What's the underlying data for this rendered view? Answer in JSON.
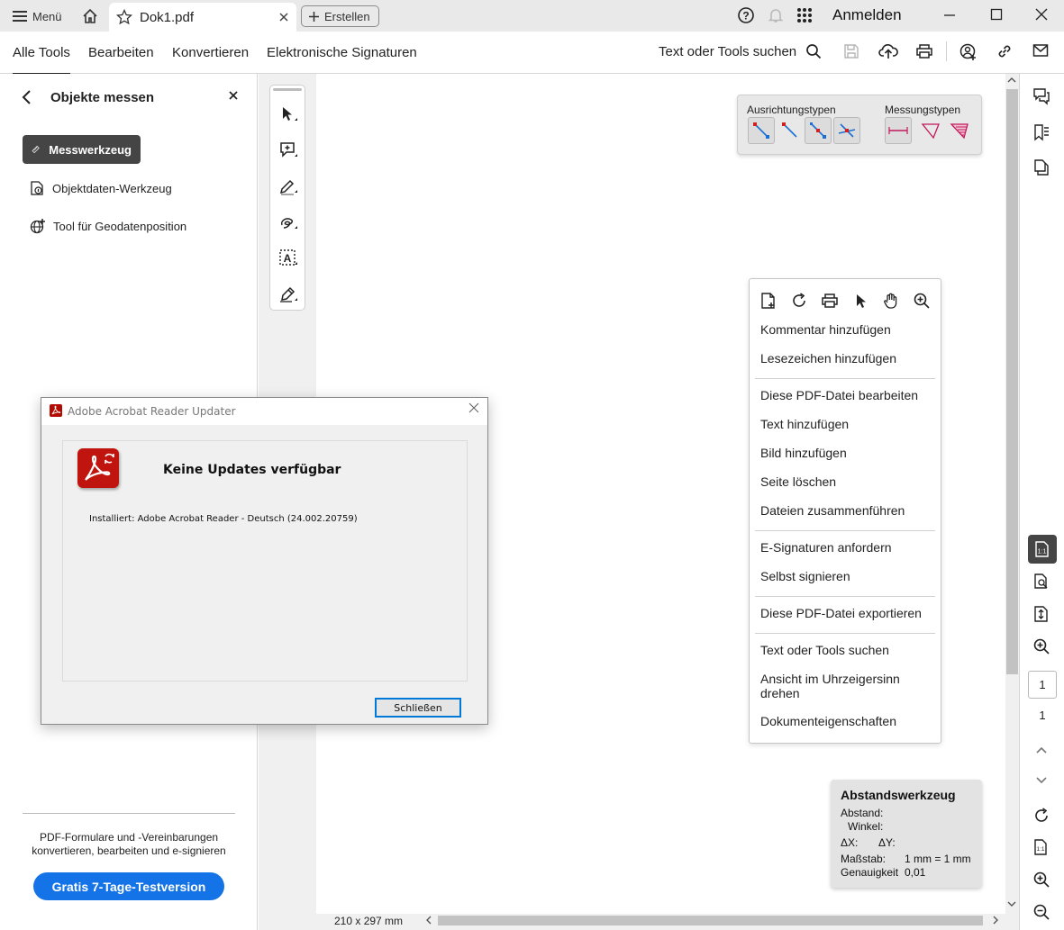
{
  "titlebar": {
    "menu_label": "Menü",
    "tab_title": "Dok1.pdf",
    "create_label": "Erstellen",
    "signin_label": "Anmelden"
  },
  "toolbar": {
    "tabs": [
      "Alle Tools",
      "Bearbeiten",
      "Konvertieren",
      "Elektronische Signaturen"
    ],
    "search_label": "Text oder Tools suchen"
  },
  "left_panel": {
    "title": "Objekte messen",
    "tools": [
      "Messwerkzeug",
      "Objektdaten-Werkzeug",
      "Tool für Geodatenposition"
    ],
    "promo_text_line1": "PDF-Formulare und -Vereinbarungen",
    "promo_text_line2": "konvertieren, bearbeiten und e-signieren",
    "promo_button": "Gratis 7-Tage-Testversion"
  },
  "measure_box": {
    "alignment_label": "Ausrichtungstypen",
    "measure_label": "Messungstypen"
  },
  "context_menu": {
    "items": [
      "Kommentar hinzufügen",
      "Lesezeichen hinzufügen",
      "Diese PDF-Datei bearbeiten",
      "Text hinzufügen",
      "Bild hinzufügen",
      "Seite löschen",
      "Dateien zusammenführen",
      "E-Signaturen anfordern",
      "Selbst signieren",
      "Diese PDF-Datei exportieren",
      "Text oder Tools suchen",
      "Ansicht im Uhrzeigersinn drehen",
      "Dokumenteigenschaften"
    ]
  },
  "distance_tool": {
    "title": "Abstandswerkzeug",
    "distance_label": "Abstand:",
    "angle_label": "Winkel:",
    "dx_label": "ΔX:",
    "dy_label": "ΔY:",
    "scale_label": "Maßstab:",
    "scale_value": "1 mm = 1 mm",
    "precision_label": "Genauigkeit",
    "precision_value": "0,01"
  },
  "status": {
    "page_size": "210 x 297 mm",
    "current_page": "1",
    "total_pages": "1"
  },
  "dialog": {
    "title": "Adobe Acrobat Reader Updater",
    "heading": "Keine Updates verfügbar",
    "installed": "Installiert: Adobe Acrobat Reader - Deutsch (24.002.20759)",
    "close_button": "Schließen"
  },
  "colors": {
    "accent": "#1473e6",
    "selected_tool": "#454545",
    "acrobat_red": "#c0150e"
  }
}
